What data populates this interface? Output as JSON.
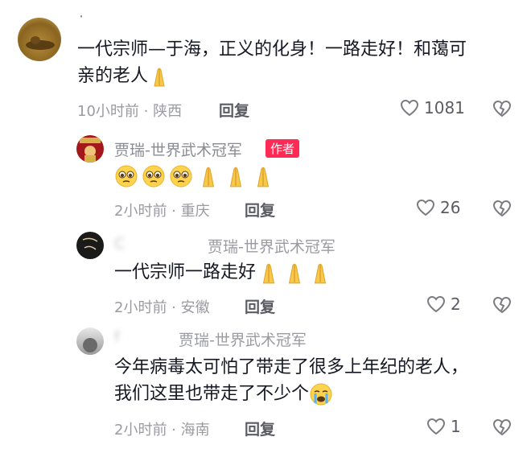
{
  "comments": [
    {
      "name": "·",
      "text_line1": "一代宗师—于海，正义的化身！一路走好！和蔼可",
      "text_line2": "亲的老人",
      "time": "10小时前 · 陕西",
      "reply": "回复",
      "likes": "1081"
    },
    {
      "name": "贾瑞-世界武术冠军",
      "badge": "作者",
      "time": "2小时前 · 重庆",
      "reply": "回复",
      "likes": "26"
    },
    {
      "name_prefix": "C",
      "name_reply": "贾瑞-世界武术冠军",
      "text": "一代宗师一路走好",
      "time": "2小时前 · 安徽",
      "reply": "回复",
      "likes": "2"
    },
    {
      "name_prefix": "f",
      "name_reply": "贾瑞-世界武术冠军",
      "text_line1": "今年病毒太可怕了带走了很多上年纪的老人，",
      "text_line2": "我们这里也带走了不少个",
      "time": "2小时前 · 海南",
      "reply": "回复",
      "likes": "1"
    }
  ],
  "colors": {
    "badge": "#fe2c55",
    "meta": "#9a9ba1"
  },
  "icons": [
    "pray-emoji",
    "pleading-face-emoji",
    "crying-face-emoji",
    "heart-outline-icon",
    "broken-heart-icon"
  ]
}
